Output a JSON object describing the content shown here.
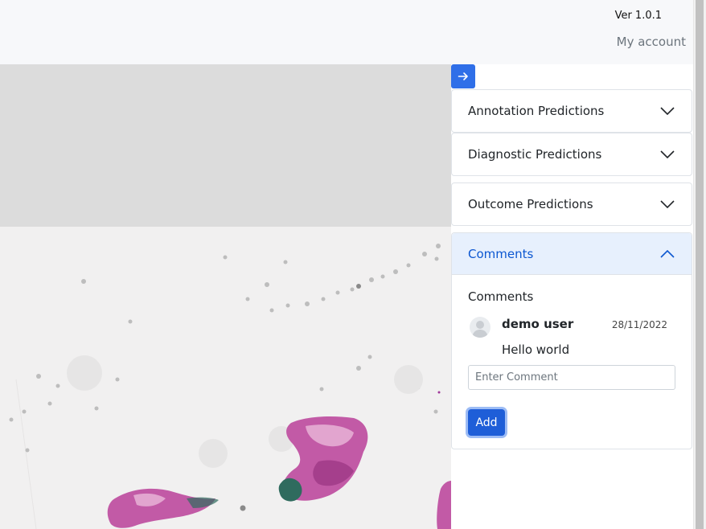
{
  "header": {
    "version": "Ver 1.0.1",
    "account": "My account"
  },
  "panel": {
    "toggle_icon": "arrow-right-icon",
    "accent": "#2f6fe8",
    "sections": [
      {
        "label": "Annotation Predictions",
        "expanded": false
      },
      {
        "label": "Diagnostic Predictions",
        "expanded": false
      },
      {
        "label": "Outcome Predictions",
        "expanded": false
      },
      {
        "label": "Comments",
        "expanded": true
      }
    ],
    "comments": {
      "title": "Comments",
      "items": [
        {
          "user": "demo user",
          "date": "28/11/2022",
          "text": "Hello world"
        }
      ],
      "input_placeholder": "Enter Comment",
      "add_label": "Add"
    }
  }
}
